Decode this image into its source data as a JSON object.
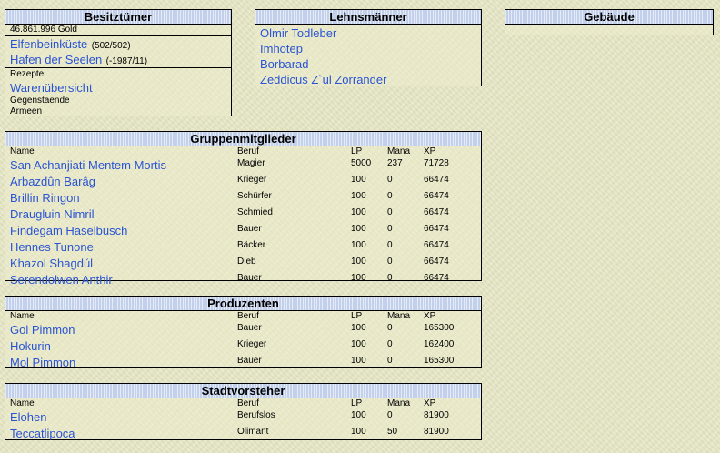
{
  "besitz": {
    "title": "Besitztümer",
    "gold": "46.861.996 Gold",
    "territories": [
      {
        "name": "Elfenbeinküste",
        "count": "(502/502)"
      },
      {
        "name": "Hafen der Seelen",
        "count": "(-1987/11)"
      }
    ],
    "rezepte": "Rezepte",
    "warenuebersicht": "Warenübersicht",
    "gegenstaende": "Gegenstaende",
    "armeen": "Armeen"
  },
  "lehns": {
    "title": "Lehnsmänner",
    "items": [
      "Olmir Todleber",
      "Imhotep",
      "Borbarad",
      "Zeddicus Z`ul Zorrander"
    ]
  },
  "gebaeude": {
    "title": "Gebäude"
  },
  "columns": {
    "name": "Name",
    "beruf": "Beruf",
    "lp": "LP",
    "mana": "Mana",
    "xp": "XP"
  },
  "gruppe": {
    "title": "Gruppenmitglieder",
    "rows": [
      {
        "name": "San Achanjiati Mentem Mortis",
        "beruf": "Magier",
        "lp": "5000",
        "mana": "237",
        "xp": "71728"
      },
      {
        "name": "Arbazdûn Barâg",
        "beruf": "Krieger",
        "lp": "100",
        "mana": "0",
        "xp": "66474"
      },
      {
        "name": "Brillin Ringon",
        "beruf": "Schürfer",
        "lp": "100",
        "mana": "0",
        "xp": "66474"
      },
      {
        "name": "Draugluin Nimril",
        "beruf": "Schmied",
        "lp": "100",
        "mana": "0",
        "xp": "66474"
      },
      {
        "name": "Findegam Haselbusch",
        "beruf": "Bauer",
        "lp": "100",
        "mana": "0",
        "xp": "66474"
      },
      {
        "name": "Hennes Tunone",
        "beruf": "Bäcker",
        "lp": "100",
        "mana": "0",
        "xp": "66474"
      },
      {
        "name": "Khazol Shagdúl",
        "beruf": "Dieb",
        "lp": "100",
        "mana": "0",
        "xp": "66474"
      },
      {
        "name": "Serendolwen Anthir",
        "beruf": "Bauer",
        "lp": "100",
        "mana": "0",
        "xp": "66474"
      }
    ]
  },
  "produzenten": {
    "title": "Produzenten",
    "rows": [
      {
        "name": "Gol Pimmon",
        "beruf": "Bauer",
        "lp": "100",
        "mana": "0",
        "xp": "165300"
      },
      {
        "name": "Hokurin",
        "beruf": "Krieger",
        "lp": "100",
        "mana": "0",
        "xp": "162400"
      },
      {
        "name": "Mol Pimmon",
        "beruf": "Bauer",
        "lp": "100",
        "mana": "0",
        "xp": "165300"
      }
    ]
  },
  "stadt": {
    "title": "Stadtvorsteher",
    "rows": [
      {
        "name": "Elohen",
        "beruf": "Berufslos",
        "lp": "100",
        "mana": "0",
        "xp": "81900"
      },
      {
        "name": "Teccatlipoca",
        "beruf": "Olimant",
        "lp": "100",
        "mana": "50",
        "xp": "81900"
      }
    ]
  }
}
